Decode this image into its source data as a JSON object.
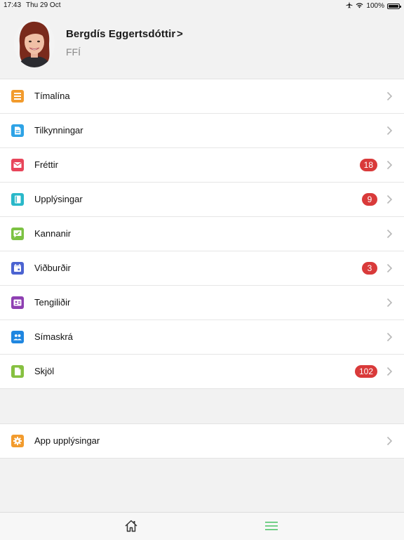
{
  "status_bar": {
    "time": "17:43",
    "date": "Thu 29 Oct",
    "battery_label": "100%",
    "icons": [
      "airplane-icon",
      "wifi-icon",
      "battery-icon"
    ]
  },
  "profile": {
    "name": "Bergdís Eggertsdóttir",
    "chevron": ">",
    "organization": "FFÍ"
  },
  "menu": {
    "items": [
      {
        "label": "Tímalína",
        "icon": "timeline-icon",
        "color": "#f29b2d",
        "badge": ""
      },
      {
        "label": "Tilkynningar",
        "icon": "announcement-icon",
        "color": "#2ea3e6",
        "badge": ""
      },
      {
        "label": "Fréttir",
        "icon": "mail-icon",
        "color": "#e8455a",
        "badge": "18"
      },
      {
        "label": "Upplýsingar",
        "icon": "info-book-icon",
        "color": "#29b8c9",
        "badge": "9"
      },
      {
        "label": "Kannanir",
        "icon": "survey-icon",
        "color": "#7cc243",
        "badge": ""
      },
      {
        "label": "Viðburðir",
        "icon": "calendar-icon",
        "color": "#4b63d1",
        "badge": "3"
      },
      {
        "label": "Tengiliðir",
        "icon": "contact-card-icon",
        "color": "#8e3fb2",
        "badge": ""
      },
      {
        "label": "Símaskrá",
        "icon": "people-icon",
        "color": "#1f86e0",
        "badge": ""
      },
      {
        "label": "Skjöl",
        "icon": "document-icon",
        "color": "#86c040",
        "badge": "102"
      }
    ]
  },
  "settings": {
    "items": [
      {
        "label": "App upplýsingar",
        "icon": "gear-icon",
        "color": "#f29b2d",
        "badge": ""
      }
    ]
  },
  "tabbar": {
    "tabs": [
      {
        "icon": "home-icon",
        "active": false
      },
      {
        "icon": "hamburger-menu-icon",
        "active": true
      }
    ],
    "active_color": "#3dbf5a",
    "inactive_color": "#333333"
  },
  "colors": {
    "badge": "#d93a3a",
    "background": "#f2f2f2"
  }
}
